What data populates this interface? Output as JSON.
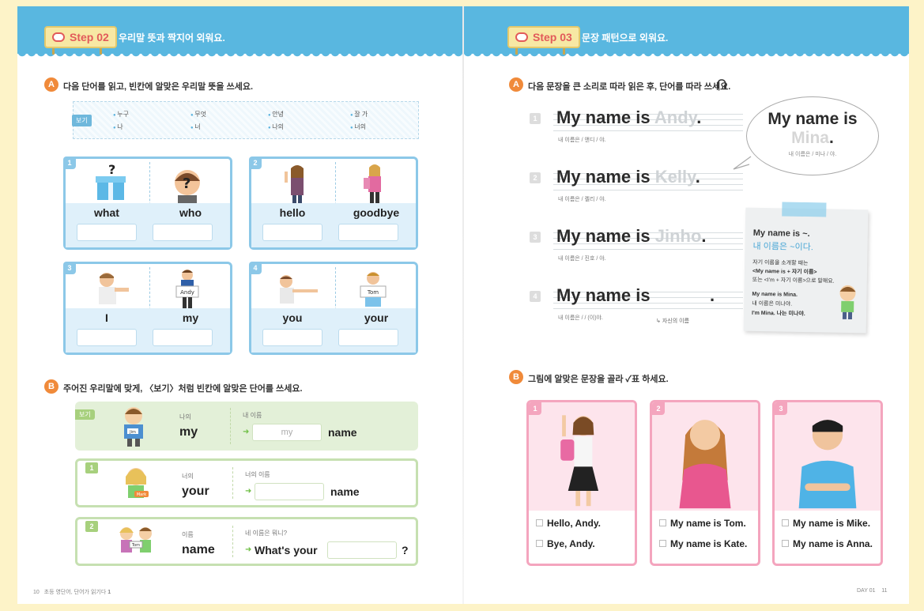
{
  "left_page": {
    "step": {
      "label": "Step 02",
      "title": "우리말 뜻과 짝지어 외워요."
    },
    "section_a": {
      "badge": "A",
      "title": "다음 단어를 읽고, 빈칸에 알맞은 우리말 뜻을 쓰세요.",
      "example_label": "보기",
      "example_words": [
        "누구",
        "무엇",
        "안녕",
        "잘 가",
        "나",
        "너",
        "나의",
        "너의"
      ],
      "cards": [
        {
          "num": "1",
          "words": [
            "what",
            "who"
          ],
          "sign": ""
        },
        {
          "num": "2",
          "words": [
            "hello",
            "goodbye"
          ],
          "sign": ""
        },
        {
          "num": "3",
          "words": [
            "I",
            "my"
          ],
          "sign": "Andy"
        },
        {
          "num": "4",
          "words": [
            "you",
            "your"
          ],
          "sign": "Tom"
        }
      ]
    },
    "section_b": {
      "badge": "B",
      "title": "주어진 우리말에 맞게, 〈보기〉처럼 빈칸에 알맞은 단어를 쓰세요.",
      "rows": [
        {
          "tag": "보기",
          "ko": "나의",
          "en": "my",
          "ko2": "내 이름",
          "answer": "my",
          "tail": "name",
          "badge": "Jim"
        },
        {
          "tag": "1",
          "ko": "너의",
          "en": "your",
          "ko2": "너의 이름",
          "answer": "",
          "tail": "name",
          "badge": "Mark"
        },
        {
          "tag": "2",
          "ko": "이름",
          "en": "name",
          "ko2": "네 이름은 뭐니?",
          "prefix": "What's your",
          "answer": "",
          "tail": "?",
          "badge": "Tom"
        }
      ]
    },
    "footer": {
      "page": "10",
      "book": "초등 영단어, 단어가 읽기다",
      "vol": "1"
    }
  },
  "right_page": {
    "step": {
      "label": "Step 03",
      "title": "문장 패턴으로 외워요."
    },
    "section_a": {
      "badge": "A",
      "title": "다음 문장을 큰 소리로 따라 읽은 후, 단어를 따라 쓰세요.",
      "rows": [
        {
          "num": "1",
          "lead": "My name is",
          "ghost": "Andy",
          "end": ".",
          "gloss": "내 이름은 / 앤디 / 야."
        },
        {
          "num": "2",
          "lead": "My name is",
          "ghost": "Kelly",
          "end": ".",
          "gloss": "내 이름은 / 켈리 / 야."
        },
        {
          "num": "3",
          "lead": "My name is",
          "ghost": "Jinho",
          "end": ".",
          "gloss": "내 이름은 / 진호 / 야."
        },
        {
          "num": "4",
          "lead": "My name is",
          "ghost": "",
          "end": ".",
          "gloss": "내 이름은 /        / (이)야.",
          "hint": "자신의 이름"
        }
      ],
      "bubble": {
        "line1": "My name is",
        "line2": "Mina",
        "end": ".",
        "gloss": "내 이름은 / 미나 / 야."
      },
      "note": {
        "title": "My name is ~.",
        "subtitle": "내 이름은 ~이다.",
        "lines": [
          "자기 이름을 소개할 때는",
          "<My name is + 자기 이름>",
          "또는 <I'm + 자기 이름>으로 말해요."
        ],
        "examples": [
          "My name is Mina.",
          "내 이름은 미나야.",
          "I'm Mina. 나는 미나야."
        ]
      }
    },
    "section_b": {
      "badge": "B",
      "title": "그림에 알맞은 문장을 골라 ✓표 하세요.",
      "cards": [
        {
          "num": "1",
          "options": [
            "Hello, Andy.",
            "Bye, Andy."
          ]
        },
        {
          "num": "2",
          "options": [
            "My name is Tom.",
            "My name is Kate."
          ]
        },
        {
          "num": "3",
          "options": [
            "My name is Mike.",
            "My name is Anna."
          ]
        }
      ]
    },
    "footer": {
      "day": "DAY 01",
      "page": "11"
    }
  }
}
